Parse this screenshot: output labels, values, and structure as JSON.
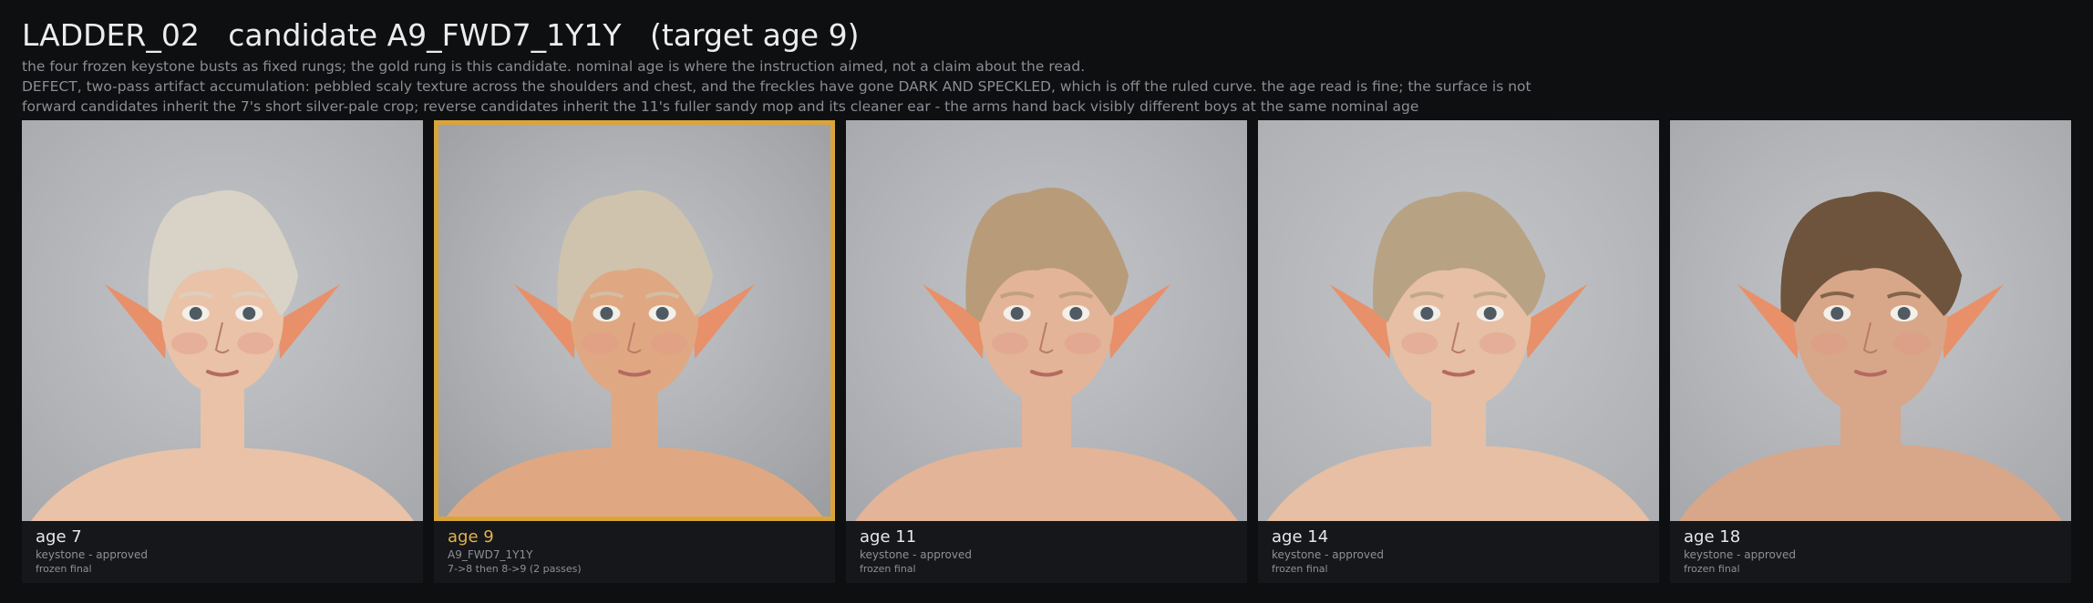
{
  "header": {
    "title": "LADDER_02   candidate A9_FWD7_1Y1Y   (target age 9)",
    "description_lines": [
      "the four frozen keystone busts as fixed rungs; the gold rung is this candidate.  nominal age is where the instruction aimed, not a claim about the read.",
      "DEFECT, two-pass artifact accumulation: pebbled scaly texture across the shoulders and chest, and the freckles have gone DARK AND SPECKLED, which is off the ruled curve.  the age read is fine; the surface is not",
      "forward candidates inherit the 7's short silver-pale crop; reverse candidates inherit the 11's fuller sandy mop and its cleaner ear - the arms hand back visibly different boys at the same nominal age"
    ]
  },
  "rungs": [
    {
      "age_label": "age 7",
      "line1": "keystone - approved",
      "line2": "frozen final",
      "selected": false,
      "hair_color": "#d9d2c6",
      "skin_color": "#e9c2a8",
      "bg_color": "#a8aaae"
    },
    {
      "age_label": "age 9",
      "line1": "A9_FWD7_1Y1Y",
      "line2": "7->8 then 8->9  (2 passes)",
      "selected": true,
      "hair_color": "#cfc3ad",
      "skin_color": "#dfa882",
      "bg_color": "#9c9ea2"
    },
    {
      "age_label": "age 11",
      "line1": "keystone - approved",
      "line2": "frozen final",
      "selected": false,
      "hair_color": "#b89b78",
      "skin_color": "#e3b497",
      "bg_color": "#a6a8ad"
    },
    {
      "age_label": "age 14",
      "line1": "keystone - approved",
      "line2": "frozen final",
      "selected": false,
      "hair_color": "#b8a284",
      "skin_color": "#e6bfa4",
      "bg_color": "#adafb3"
    },
    {
      "age_label": "age 18",
      "line1": "keystone - approved",
      "line2": "frozen final",
      "selected": false,
      "hair_color": "#6e543c",
      "skin_color": "#d8a688",
      "bg_color": "#a7a9ad"
    }
  ]
}
